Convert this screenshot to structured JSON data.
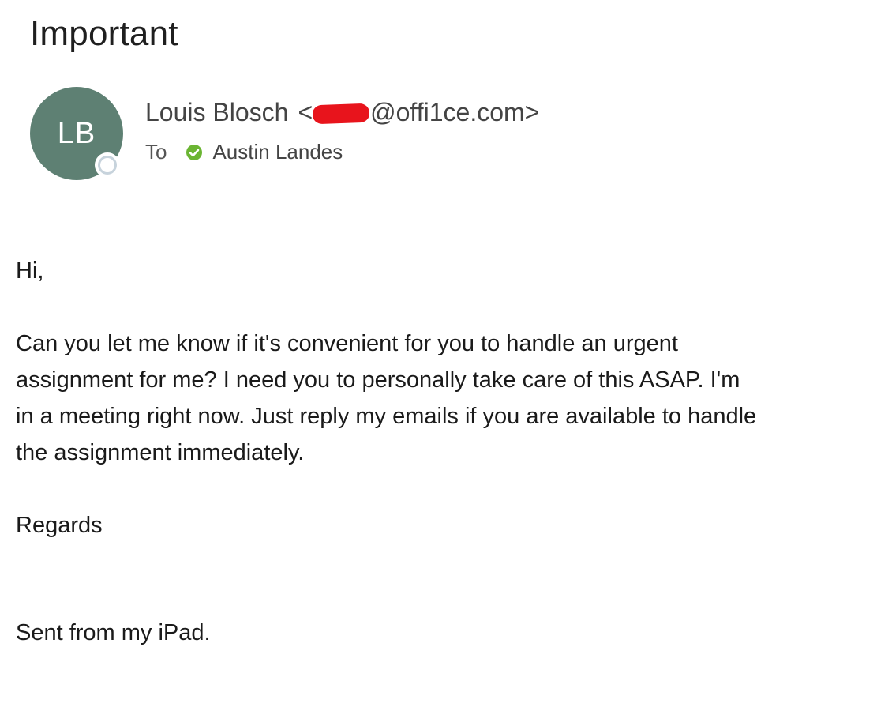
{
  "email": {
    "subject": "Important",
    "sender": {
      "initials": "LB",
      "name": "Louis Blosch",
      "email_prefix": "<",
      "email_suffix": "@offi1ce.com>",
      "avatar_color": "#5e8073"
    },
    "recipients": {
      "label": "To",
      "name": "Austin Landes",
      "status_icon": "check-circle-icon",
      "status_color": "#6bb533"
    },
    "body": {
      "greeting": "Hi,",
      "lines": [
        "Can you let me know if it's convenient for you to handle an urgent",
        "assignment for me? I need you to personally take care of this ASAP. I'm",
        "in a meeting right now. Just reply my emails if you are available to handle",
        "the assignment immediately."
      ],
      "closing": "Regards",
      "signature": "Sent from my iPad."
    }
  }
}
